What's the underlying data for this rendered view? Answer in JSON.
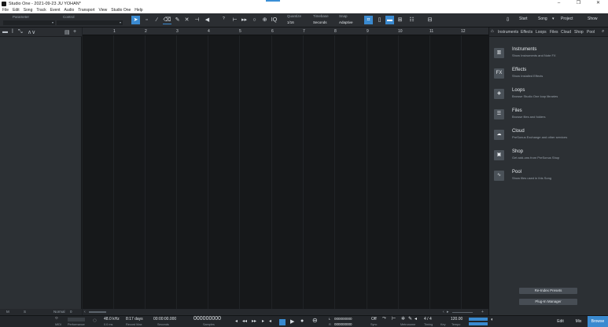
{
  "window": {
    "title": "Studio One - 2021-09-23 JU YOHAN*",
    "minimize": "–",
    "maximize": "❐",
    "close": "✕"
  },
  "menu": [
    "File",
    "Edit",
    "Song",
    "Track",
    "Event",
    "Audio",
    "Transport",
    "View",
    "Studio One",
    "Help"
  ],
  "toolbar": {
    "parameter_label": "Parameter",
    "control_label": "Control",
    "help": "?",
    "quantize_label": "Quantize",
    "quantize_value": "1/16",
    "timebase_label": "Timebase",
    "timebase_value": "Seconds",
    "snap_label": "Snap",
    "snap_value": "Adaptive",
    "iq": "IQ",
    "start": "Start",
    "song": "Song",
    "project": "Project",
    "show": "Show"
  },
  "ruler": {
    "bars": [
      "1",
      "2",
      "3",
      "4",
      "5",
      "6",
      "7",
      "8",
      "9",
      "10",
      "11",
      "12"
    ]
  },
  "inspector": {
    "m": "M",
    "s": "S",
    "mode": "Normal",
    "zero": "0"
  },
  "browser": {
    "tabs": [
      "Instruments",
      "Effects",
      "Loops",
      "Files",
      "Cloud",
      "Shop",
      "Pool"
    ],
    "items": [
      {
        "title": "Instruments",
        "desc": "Show Instruments and Note FX",
        "icon": "piano-icon",
        "glyph": "▥"
      },
      {
        "title": "Effects",
        "desc": "Show Installed Effects",
        "icon": "fx-icon",
        "glyph": "FX"
      },
      {
        "title": "Loops",
        "desc": "Browse Studio One loop libraries",
        "icon": "loops-icon",
        "glyph": "◈"
      },
      {
        "title": "Files",
        "desc": "Browse files and folders",
        "icon": "files-icon",
        "glyph": "☰"
      },
      {
        "title": "Cloud",
        "desc": "PreSonus Exchange and other services",
        "icon": "cloud-icon",
        "glyph": "☁"
      },
      {
        "title": "Shop",
        "desc": "Get add-ons from PreSonus Shop",
        "icon": "shop-icon",
        "glyph": "▣"
      },
      {
        "title": "Pool",
        "desc": "Show files used in this Song",
        "icon": "pool-icon",
        "glyph": "∿"
      }
    ],
    "reindex": "Re-Index Presets",
    "plugin_manager": "Plug-In Manager"
  },
  "transport": {
    "midi": "MIDI",
    "performance": "Performance",
    "sample_rate": "48.0 kHz",
    "latency": "0.0 ms",
    "record_max_value": "8:17 days",
    "record_max_label": "Record Max",
    "seconds_value": "00:00:00.000",
    "seconds_label": "Seconds",
    "samples_value": "000000000",
    "samples_label": "Samples",
    "loop_l": "000000000",
    "loop_r": "000000000",
    "sync_value": "Off",
    "sync_label": "Sync",
    "metronome_label": "Metronome",
    "timing_value": "4 / 4",
    "timing_label": "Timing",
    "key_label": "Key",
    "tempo_value": "120.00",
    "tempo_label": "Tempo",
    "edit": "Edit",
    "mix": "Mix",
    "browse": "Browse"
  },
  "colors": {
    "accent": "#3a8ad0",
    "panel": "#2c3034",
    "arrange_bg": "#16181a"
  }
}
